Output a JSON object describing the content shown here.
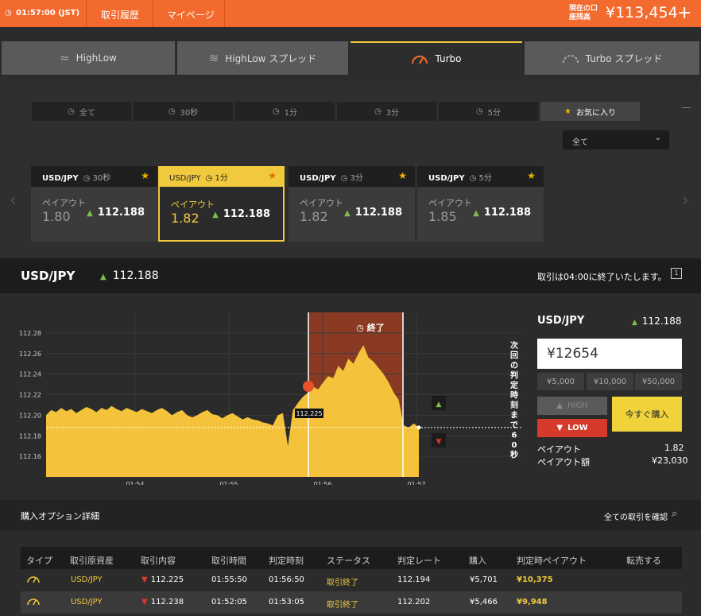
{
  "topbar": {
    "time": "01:57:00 (JST)",
    "nav": [
      "取引履歴",
      "マイページ"
    ],
    "balance_label": "現在の口座残高",
    "balance_value": "¥113,454",
    "plus": "+"
  },
  "product_tabs": [
    {
      "label": "HighLow",
      "icon": "waves-icon",
      "active": false
    },
    {
      "label": "HighLow スプレッド",
      "icon": "waves-spread-icon",
      "active": false
    },
    {
      "label": "Turbo",
      "icon": "speedometer-icon",
      "active": true
    },
    {
      "label": "Turbo スプレッド",
      "icon": "speedometer-dashed-icon",
      "active": false
    }
  ],
  "filter_tabs": [
    {
      "label": "全て",
      "icon": "clock-icon",
      "active": false
    },
    {
      "label": "30秒",
      "icon": "clock-icon",
      "active": false
    },
    {
      "label": "1分",
      "icon": "clock-icon",
      "active": false
    },
    {
      "label": "3分",
      "icon": "clock-icon",
      "active": false
    },
    {
      "label": "5分",
      "icon": "clock-icon",
      "active": false
    },
    {
      "label": "お気に入り",
      "icon": "star-icon",
      "active": true
    }
  ],
  "dropdown": {
    "value": "全て"
  },
  "cards": [
    {
      "pair": "USD/JPY",
      "duration": "30秒",
      "payout_label": "ペイアウト",
      "payout": "1.80",
      "rate": "112.188",
      "selected": false
    },
    {
      "pair": "USD/JPY",
      "duration": "1分",
      "payout_label": "ペイアウト",
      "payout": "1.82",
      "rate": "112.188",
      "selected": true
    },
    {
      "pair": "USD/JPY",
      "duration": "3分",
      "payout_label": "ペイアウト",
      "payout": "1.82",
      "rate": "112.188",
      "selected": false
    },
    {
      "pair": "USD/JPY",
      "duration": "5分",
      "payout_label": "ペイアウト",
      "payout": "1.85",
      "rate": "112.188",
      "selected": false
    }
  ],
  "pairbar": {
    "pair": "USD/JPY",
    "rate": "112.188",
    "notice": "取引は04:00に終了いたします。"
  },
  "chart_data": {
    "type": "area",
    "y_ticks": [
      "112.28",
      "112.26",
      "112.24",
      "112.22",
      "112.20",
      "112.18",
      "112.16"
    ],
    "x_ticks": [
      "01:54",
      "01:55",
      "01:56",
      "01:57"
    ],
    "ylim": [
      112.14,
      112.3
    ],
    "end_label": "終了",
    "countdown": "次回の判定時刻まで60秒",
    "marker_value": "112.225",
    "current_value": 112.188,
    "series": [
      {
        "values": [
          112.2,
          112.205,
          112.203,
          112.207,
          112.204,
          112.206,
          112.202,
          112.205,
          112.208,
          112.206,
          112.203,
          112.207,
          112.205,
          112.209,
          112.206,
          112.204,
          112.207,
          112.205,
          112.203,
          112.206,
          112.204,
          112.202,
          112.205,
          112.207,
          112.204,
          112.2,
          112.203,
          112.205,
          112.2,
          112.198,
          112.2,
          112.203,
          112.205,
          112.201,
          112.2,
          112.197,
          112.2,
          112.202,
          112.199,
          112.196,
          112.198,
          112.196,
          112.195,
          112.193,
          112.192,
          112.19,
          112.2,
          112.202,
          112.17,
          112.205,
          112.212,
          112.218,
          112.222,
          112.228,
          112.225,
          112.232,
          112.238,
          112.236,
          112.248,
          112.243,
          112.255,
          112.25,
          112.26,
          112.268,
          112.256,
          112.252,
          112.246,
          112.24,
          112.232,
          112.222,
          112.215,
          112.19,
          112.188,
          112.192,
          112.188
        ]
      }
    ]
  },
  "trade_panel": {
    "pair": "USD/JPY",
    "rate": "112.188",
    "amount": "¥12654",
    "quick_amounts": [
      "¥5,000",
      "¥10,000",
      "¥50,000"
    ],
    "high_label": "HIGH",
    "low_label": "LOW",
    "buy_label": "今すぐ購入",
    "payout_label": "ペイアウト",
    "payout_value": "1.82",
    "payout_amount_label": "ペイアウト額",
    "payout_amount_value": "¥23,030"
  },
  "details": {
    "title": "購入オプション詳細",
    "link": "全ての取引を確認",
    "headers": [
      "タイプ",
      "取引原資産",
      "取引内容",
      "取引時間",
      "判定時刻",
      "ステータス",
      "判定レート",
      "購入",
      "判定時ペイアウト",
      "転売する"
    ],
    "rows": [
      {
        "asset": "USD/JPY",
        "content": "112.225",
        "time": "01:55:50",
        "judge": "01:56:50",
        "status": "取引終了",
        "rate": "112.194",
        "buy": "¥5,701",
        "payout": "¥10,375"
      },
      {
        "asset": "USD/JPY",
        "content": "112.238",
        "time": "01:52:05",
        "judge": "01:53:05",
        "status": "取引終了",
        "rate": "112.202",
        "buy": "¥5,466",
        "payout": "¥9,948"
      }
    ]
  }
}
